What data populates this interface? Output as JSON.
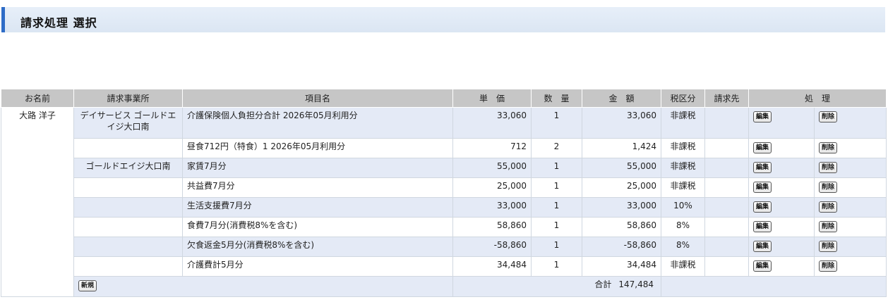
{
  "page": {
    "title": "請求処理 選択"
  },
  "table": {
    "headers": [
      "お名前",
      "請求事業所",
      "項目名",
      "単　価",
      "数　量",
      "金　額",
      "税区分",
      "請求先",
      "処　理"
    ],
    "resident_name": "大路 洋子",
    "rows": [
      {
        "office": "デイサービス ゴールドエイジ大口南",
        "item": "介護保険個人負担分合計 2026年05月利用分",
        "price": "33,060",
        "qty": "1",
        "amount": "33,060",
        "tax": "非課税",
        "dest": ""
      },
      {
        "office": "",
        "item": "昼食712円（特食）1 2026年05月利用分",
        "price": "712",
        "qty": "2",
        "amount": "1,424",
        "tax": "非課税",
        "dest": ""
      },
      {
        "office": "ゴールドエイジ大口南",
        "item": "家賃7月分",
        "price": "55,000",
        "qty": "1",
        "amount": "55,000",
        "tax": "非課税",
        "dest": ""
      },
      {
        "office": "",
        "item": "共益費7月分",
        "price": "25,000",
        "qty": "1",
        "amount": "25,000",
        "tax": "非課税",
        "dest": ""
      },
      {
        "office": "",
        "item": "生活支援費7月分",
        "price": "33,000",
        "qty": "1",
        "amount": "33,000",
        "tax": "10%",
        "dest": ""
      },
      {
        "office": "",
        "item": "食費7月分(消費税8%を含む)",
        "price": "58,860",
        "qty": "1",
        "amount": "58,860",
        "tax": "8%",
        "dest": ""
      },
      {
        "office": "",
        "item": "欠食返金5月分(消費税8%を含む)",
        "price": "-58,860",
        "qty": "1",
        "amount": "-58,860",
        "tax": "8%",
        "dest": ""
      },
      {
        "office": "",
        "item": "介護費計5月分",
        "price": "34,484",
        "qty": "1",
        "amount": "34,484",
        "tax": "非課税",
        "dest": ""
      }
    ],
    "edit_label": "編集",
    "delete_label": "削除",
    "new_label": "新規",
    "total_label": "合計",
    "total_value": "147,484"
  }
}
